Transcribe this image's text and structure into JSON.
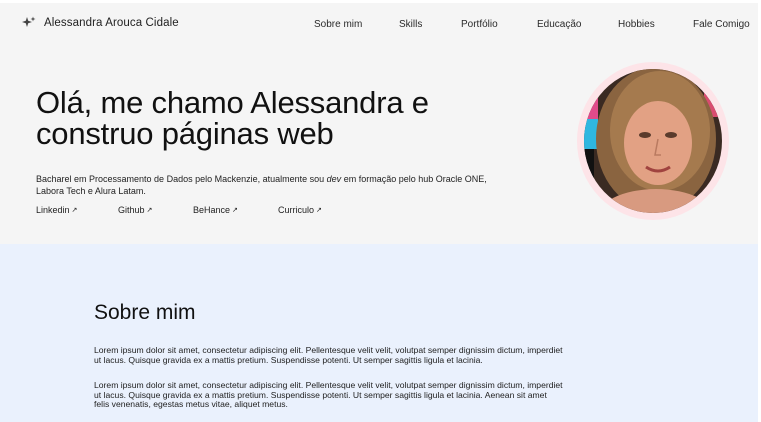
{
  "brand": {
    "name": "Alessandra Arouca Cidale",
    "icon": "sparkles-icon"
  },
  "nav": {
    "items": [
      {
        "label": "Sobre mim"
      },
      {
        "label": "Skills"
      },
      {
        "label": "Portfólio"
      },
      {
        "label": "Educação"
      },
      {
        "label": "Hobbies"
      },
      {
        "label": "Fale Comigo"
      }
    ]
  },
  "hero": {
    "title_line1": "Olá, me chamo Alessandra e",
    "title_line2": "construo páginas web",
    "desc_before": "Bacharel em Processamento de Dados pelo Mackenzie, atualmente sou ",
    "desc_em": "dev",
    "desc_after": " em formação pelo hub Oracle ONE, Labora Tech e Alura Latam.",
    "links": [
      {
        "label": "Linkedin",
        "icon": "arrow-up-right-icon"
      },
      {
        "label": "Github",
        "icon": "arrow-up-right-icon"
      },
      {
        "label": "BeHance",
        "icon": "arrow-up-right-icon"
      },
      {
        "label": "Curriculo",
        "icon": "arrow-up-right-icon"
      }
    ],
    "avatar": "profile-photo"
  },
  "about": {
    "title": "Sobre mim",
    "p1": "Lorem ipsum dolor sit amet, consectetur adipiscing elit. Pellentesque velit velit, volutpat semper dignissim dictum, imperdiet ut lacus. Quisque gravida ex a mattis pretium. Suspendisse potenti. Ut semper sagittis ligula et lacinia.",
    "p2": "Lorem ipsum dolor sit amet, consectetur adipiscing elit. Pellentesque velit velit, volutpat semper dignissim dictum, imperdiet ut lacus. Quisque gravida ex a mattis pretium. Suspendisse potenti. Ut semper sagittis ligula et lacinia. Aenean sit amet felis venenatis, egestas metus vitae, aliquet metus."
  },
  "colors": {
    "hero_bg": "#f5f5f5",
    "about_bg": "#eaf1fd",
    "avatar_ring": "#fde4e8",
    "text": "#1f1f1f"
  }
}
